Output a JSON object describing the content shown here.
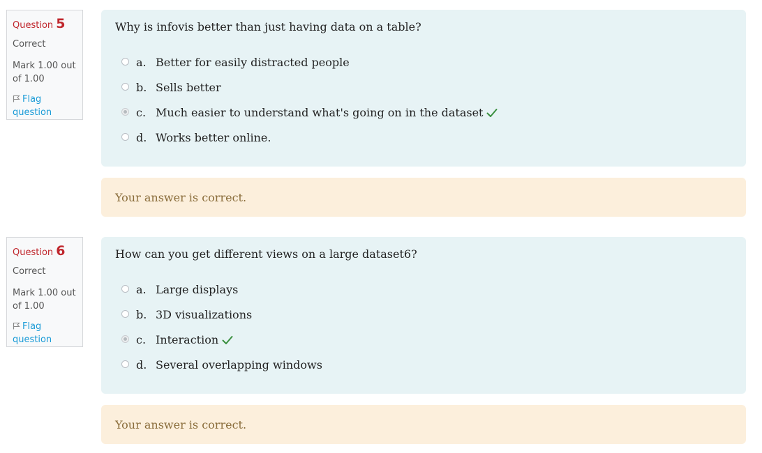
{
  "questions": [
    {
      "label": "Question",
      "number": "5",
      "state": "Correct",
      "grade": "Mark 1.00 out of 1.00",
      "flag_label": "Flag question",
      "text": "Why is infovis better than just having data on a table?",
      "answers": [
        {
          "letter": "a.",
          "text": "Better for easily distracted people",
          "selected": false
        },
        {
          "letter": "b.",
          "text": "Sells better",
          "selected": false
        },
        {
          "letter": "c.",
          "text": "Much easier to understand what's going on in the dataset",
          "selected": true,
          "icon": "checkmark-icon"
        },
        {
          "letter": "d.",
          "text": "Works better online.",
          "selected": false
        }
      ],
      "feedback": "Your answer is correct."
    },
    {
      "label": "Question",
      "number": "6",
      "state": "Correct",
      "grade": "Mark 1.00 out of 1.00",
      "flag_label": "Flag question",
      "text": "How can you get different views on a large dataset6?",
      "answers": [
        {
          "letter": "a.",
          "text": "Large displays",
          "selected": false
        },
        {
          "letter": "b.",
          "text": "3D visualizations",
          "selected": false
        },
        {
          "letter": "c.",
          "text": "Interaction",
          "selected": true,
          "icon": "checkmark-icon"
        },
        {
          "letter": "d.",
          "text": "Several overlapping windows",
          "selected": false
        }
      ],
      "feedback": "Your answer is correct."
    }
  ],
  "colors": {
    "question_number": "#c0272d",
    "link": "#1a9bd7",
    "formulation_bg": "#e7f3f5",
    "feedback_bg": "#fcefdc",
    "feedback_text": "#8a6d3b",
    "correct_check": "#3a8f3f"
  }
}
